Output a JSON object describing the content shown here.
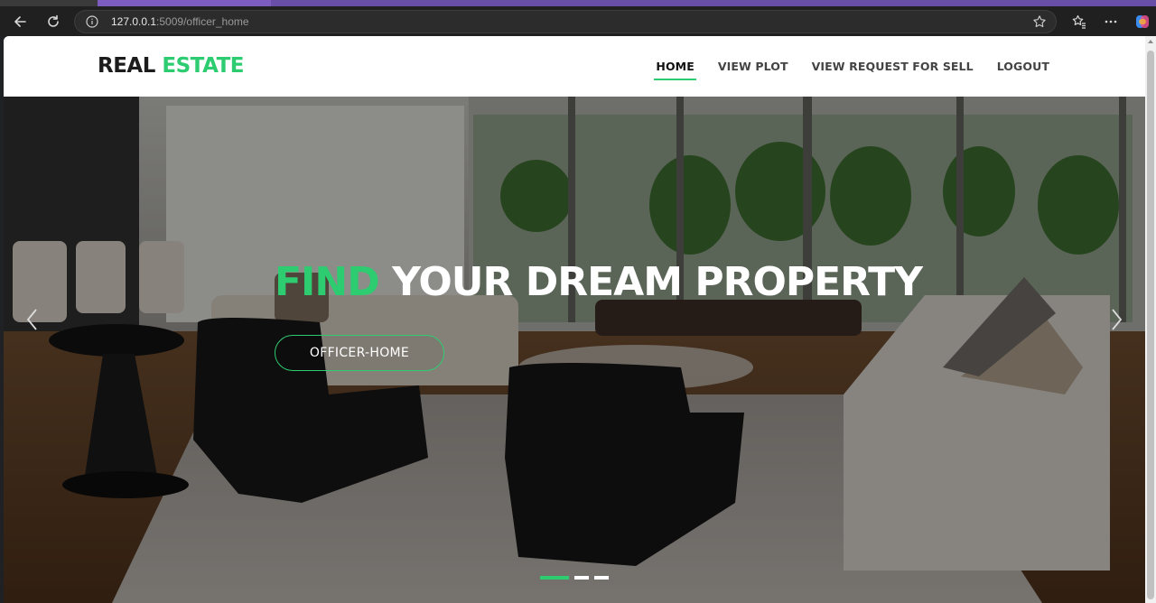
{
  "browser": {
    "url_host": "127.0.0.1",
    "url_rest": ":5009/officer_home"
  },
  "site": {
    "logo_main": "REAL ",
    "logo_accent": "ESTATE",
    "nav": [
      "HOME",
      "VIEW PLOT",
      "VIEW REQUEST FOR SELL",
      "LOGOUT"
    ],
    "active_nav": "HOME"
  },
  "hero": {
    "title_accent": "FIND",
    "title_rest": " YOUR DREAM PROPERTY",
    "button_label": "OFFICER-HOME",
    "slides_total": 3,
    "active_slide": 1
  },
  "colors": {
    "accent": "#2ecc71",
    "browser_tab_accent": "#6a4fa8"
  }
}
